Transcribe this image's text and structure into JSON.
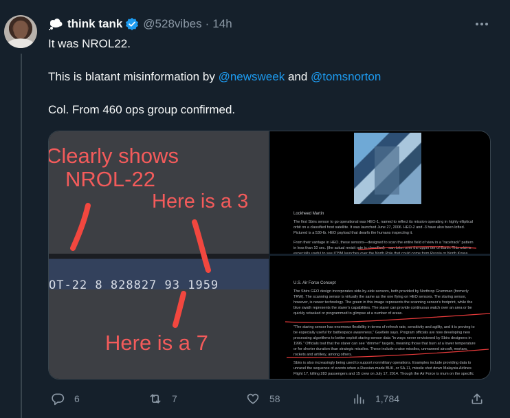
{
  "tweet": {
    "display_name": "think tank",
    "handle": "@528vibes",
    "separator": "·",
    "time": "14h",
    "lines": [
      "It was NROL22.",
      "This is blatant misinformation by",
      "and",
      "Col. From 460 ops group confirmed."
    ],
    "mentions": [
      "@newsweek",
      "@tomsnorton"
    ]
  },
  "media": {
    "left_image": {
      "annotations": [
        "Clearly shows",
        "NROL-22",
        "Here is a 3",
        "Here is a 7"
      ],
      "strip_text": "OT-22   8  828827   93  1959"
    },
    "right_top": {
      "caption_title": "Lockheed Martin",
      "para1": "The first Sbirs sensor to go operational was HEO-1, named to reflect its mission operating in highly elliptical orbit on a classified host satellite. It was launched June 27, 2006. HEO-2 and -3 have also been lofted. Pictured is a 530-lb. HEO payload that dwarfs the humans inspecting it.",
      "para2": "From their vantage in HEO, these sensors—designed to scan the entire field of view in a \"racetrack\" pattern in less than 10 sec. (the actual revisit rate is classified)—can loiter over the upper tier of Earth. This orbit is especially useful to see ICBM launches over the North Pole that could come from Russia or North Korea."
    },
    "right_bottom": {
      "title": "U.S. Air Force Concept",
      "para1": "The Sbirs GEO design incorporates side-by-side sensors, both provided by Northrop Grumman (formerly TRW). The scanning sensor is virtually the same as the one flying on HEO sensors. The staring sensor, however, is newer technology. The green in this image represents the scanning sensor's footprint, while the blue swath represents the starer's capabilities. The starer can provide continuous watch over an area or be quickly retasked or programmed to glimpse at a number of areas.",
      "para2": "\"The staring sensor has enormous flexibility in terms of refresh rate, sensitivity and agility, and it is proving to be especially useful for battlespace awareness,\" Guetlein says. Program officials are now developing new processing algorithms to better exploit staring-sensor data \"in ways never envisioned by Sbirs designers in 1996.\" Officials tout that the starer can see \"dimmer\" targets, meaning those that burn at a lower temperature or for shorter duration than strategic missiles. These include cruise missiles, unmanned aircraft, mortars, rockets and artillery, among others.",
      "para3": "Sbirs is also increasingly being used to support nonmilitary operations. Examples include providing data to unravel the sequence of events when a Russian-made BUK, or SA-11, missile shot down Malaysia Airlines Flight 17, killing 283 passengers and 15 crew on July 17, 2014. Though the Air Force is mum on the specific"
    }
  },
  "actions": {
    "replies": "6",
    "reposts": "7",
    "likes": "58",
    "views": "1,784"
  },
  "icons": {
    "reply": "reply-icon",
    "repost": "repost-icon",
    "like": "like-icon",
    "views": "views-icon",
    "share": "share-icon",
    "verified": "verified-badge-icon",
    "more": "more-icon",
    "emoji": "cloud-emoji-icon"
  },
  "colors": {
    "background": "#15202b",
    "text": "#f7f9f9",
    "secondary": "#8b98a5",
    "link": "#1d9bf0",
    "annotation_red": "#f45b5b"
  }
}
